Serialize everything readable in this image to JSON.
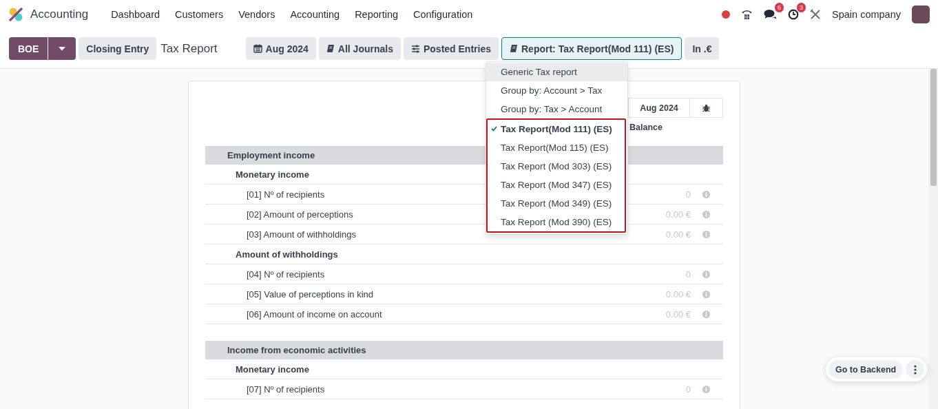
{
  "navbar": {
    "app_name": "Accounting",
    "menu": [
      "Dashboard",
      "Customers",
      "Vendors",
      "Accounting",
      "Reporting",
      "Configuration"
    ],
    "chat_badge": "6",
    "activity_badge": "3",
    "company": "Spain company"
  },
  "control_panel": {
    "primary_button": "BOE",
    "secondary_button": "Closing Entry",
    "breadcrumb": "Tax Report",
    "filters": [
      {
        "kind": "date",
        "label": "Aug 2024",
        "open": false
      },
      {
        "kind": "journals",
        "label": "All Journals",
        "open": false
      },
      {
        "kind": "entries",
        "label": "Posted Entries",
        "open": false
      },
      {
        "kind": "report",
        "label": "Report: Tax Report(Mod 111) (ES)",
        "open": true
      },
      {
        "kind": "currency",
        "label": "In .€",
        "open": false
      }
    ]
  },
  "report_dropdown": {
    "items": [
      {
        "label": "Generic Tax report",
        "selected": false,
        "hovered": true
      },
      {
        "label": "Group by: Account > Tax",
        "selected": false,
        "hovered": false
      },
      {
        "label": "Group by: Tax > Account",
        "selected": false,
        "hovered": false
      }
    ],
    "highlighted_items": [
      {
        "label": "Tax Report(Mod 111) (ES)",
        "selected": true,
        "hovered": false
      },
      {
        "label": "Tax Report(Mod 115) (ES)",
        "selected": false,
        "hovered": false
      },
      {
        "label": "Tax Report (Mod 303) (ES)",
        "selected": false,
        "hovered": false
      },
      {
        "label": "Tax Report (Mod 347) (ES)",
        "selected": false,
        "hovered": false
      },
      {
        "label": "Tax Report (Mod 349) (ES)",
        "selected": false,
        "hovered": false
      },
      {
        "label": "Tax Report (Mod 390) (ES)",
        "selected": false,
        "hovered": false
      }
    ]
  },
  "report": {
    "period": "Aug 2024",
    "column": "Balance",
    "rows": [
      {
        "kind": "section",
        "label": "Employment income"
      },
      {
        "kind": "group",
        "label": "Monetary income"
      },
      {
        "kind": "line",
        "label": "[01] Nº of recipients",
        "value": "0"
      },
      {
        "kind": "line",
        "label": "[02] Amount of perceptions",
        "value": "0.00 €"
      },
      {
        "kind": "line",
        "label": "[03] Amount of withholdings",
        "value": "0.00 €"
      },
      {
        "kind": "group",
        "label": "Amount of withholdings"
      },
      {
        "kind": "line",
        "label": "[04] Nº of recipients",
        "value": "0"
      },
      {
        "kind": "line",
        "label": "[05] Value of perceptions in kind",
        "value": "0.00 €"
      },
      {
        "kind": "line",
        "label": "[06] Amount of income on account",
        "value": "0.00 €"
      },
      {
        "kind": "spacer"
      },
      {
        "kind": "section",
        "label": "Income from economic activities"
      },
      {
        "kind": "group",
        "label": "Monetary income"
      },
      {
        "kind": "line",
        "label": "[07] Nº of recipients",
        "value": "0"
      }
    ]
  },
  "floating_actions": {
    "button": "Go to Backend"
  }
}
